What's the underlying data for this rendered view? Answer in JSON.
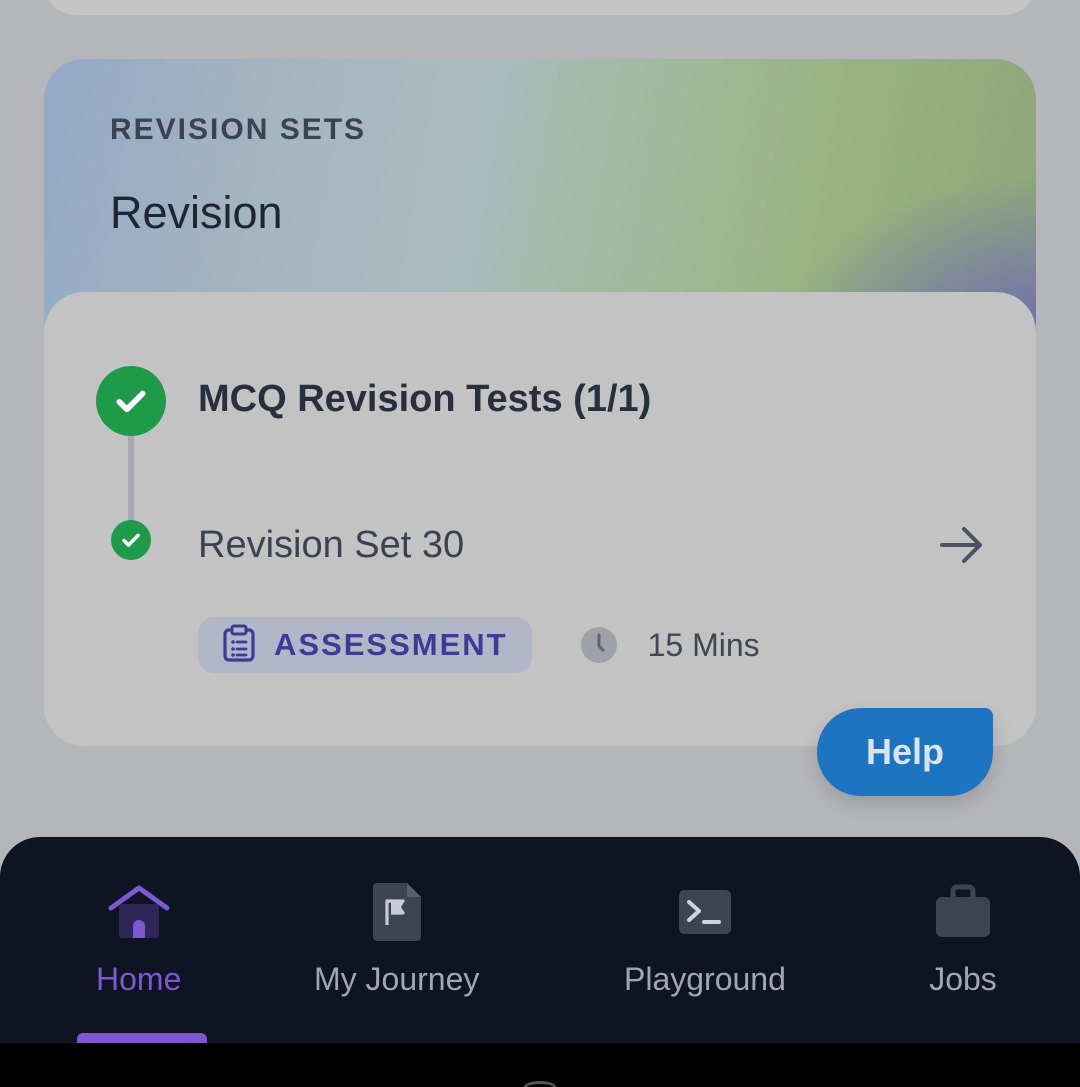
{
  "revision": {
    "section_label": "REVISION SETS",
    "section_title": "Revision",
    "group_title": "MCQ Revision Tests (1/1)",
    "item_title": "Revision Set 30",
    "badge_label": "ASSESSMENT",
    "duration": "15 Mins"
  },
  "help_label": "Help",
  "nav": {
    "items": [
      {
        "label": "Home",
        "icon": "home-icon",
        "active": true
      },
      {
        "label": "My Journey",
        "icon": "flag-file-icon",
        "active": false
      },
      {
        "label": "Playground",
        "icon": "terminal-icon",
        "active": false
      },
      {
        "label": "Jobs",
        "icon": "briefcase-icon",
        "active": false
      }
    ]
  },
  "colors": {
    "success": "#1f9a48",
    "accent": "#7e58d0",
    "help": "#1d74c0",
    "nav_bg": "#0e1422"
  }
}
